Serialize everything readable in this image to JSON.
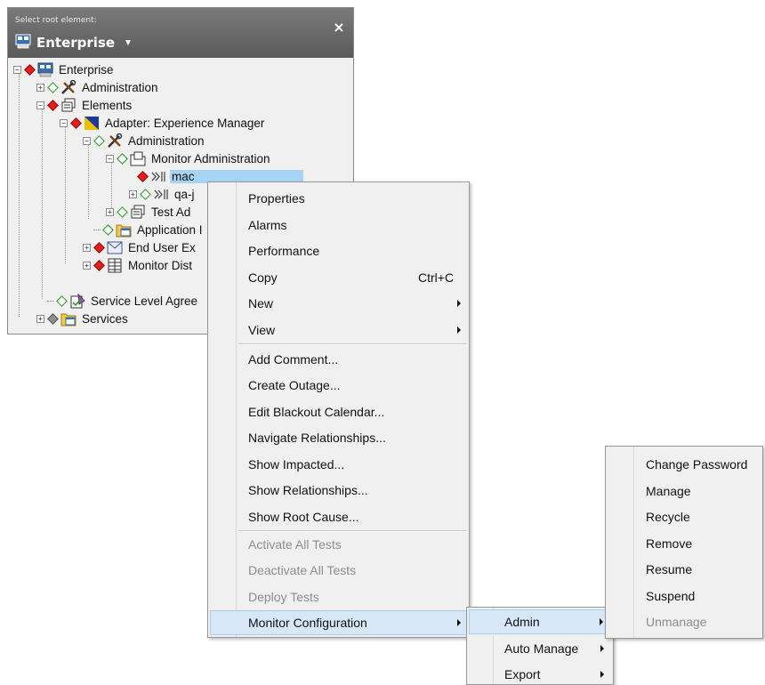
{
  "root_panel": {
    "caption": "Select root element:",
    "selected": "Enterprise",
    "close_glyph": "×"
  },
  "tree": {
    "items": [
      {
        "label": "Enterprise",
        "status": "red",
        "icon": "enterprise-icon",
        "expander": "minus"
      },
      {
        "label": "Administration",
        "status": "green",
        "icon": "tools-icon",
        "expander": "plus"
      },
      {
        "label": "Elements",
        "status": "red",
        "icon": "elements-icon",
        "expander": "minus"
      },
      {
        "label": "Adapter: Experience Manager",
        "status": "red",
        "icon": "adapter-icon",
        "expander": "minus"
      },
      {
        "label": "Administration",
        "status": "green",
        "icon": "tools-icon",
        "expander": "minus"
      },
      {
        "label": "Monitor Administration",
        "status": "green",
        "icon": "folder-icon",
        "expander": "minus"
      },
      {
        "label": "mac",
        "status": "red",
        "icon": "monitor-icon",
        "expander": "none",
        "selected": true
      },
      {
        "label": "qa-j",
        "status": "green",
        "icon": "monitor-icon",
        "expander": "plus"
      },
      {
        "label": "Test Ad",
        "status": "green",
        "icon": "elements-icon",
        "expander": "plus"
      },
      {
        "label": "Application I",
        "status": "green",
        "icon": "calendar-folder-icon",
        "expander": "none"
      },
      {
        "label": "End User Ex",
        "status": "red",
        "icon": "envelope-icon",
        "expander": "plus"
      },
      {
        "label": "Monitor Dist",
        "status": "red",
        "icon": "grid-icon",
        "expander": "plus"
      },
      {
        "label": "Service Level Agree",
        "status": "green",
        "icon": "sla-icon",
        "expander": "none"
      },
      {
        "label": "Services",
        "status": "gray",
        "icon": "calendar-folder-icon",
        "expander": "plus"
      }
    ]
  },
  "context_menu": {
    "items": [
      {
        "label": "Properties"
      },
      {
        "label": "Alarms"
      },
      {
        "label": "Performance"
      },
      {
        "label": "Copy",
        "shortcut": "Ctrl+C"
      },
      {
        "label": "New",
        "submenu": true
      },
      {
        "label": "View",
        "submenu": true
      },
      {
        "label": "Add Comment..."
      },
      {
        "label": "Create Outage..."
      },
      {
        "label": "Edit Blackout Calendar..."
      },
      {
        "label": "Navigate Relationships..."
      },
      {
        "label": "Show Impacted..."
      },
      {
        "label": "Show Relationships..."
      },
      {
        "label": "Show Root Cause..."
      },
      {
        "label": "Activate All Tests",
        "disabled": true
      },
      {
        "label": "Deactivate All Tests",
        "disabled": true
      },
      {
        "label": "Deploy Tests",
        "disabled": true
      },
      {
        "label": "Monitor Configuration",
        "submenu": true,
        "highlighted": true
      }
    ]
  },
  "monitor_config_menu": {
    "items": [
      {
        "label": "Admin",
        "submenu": true,
        "highlighted": true
      },
      {
        "label": "Auto Manage",
        "submenu": true
      },
      {
        "label": "Export",
        "submenu": true
      }
    ]
  },
  "admin_menu": {
    "items": [
      {
        "label": "Change Password"
      },
      {
        "label": "Manage"
      },
      {
        "label": "Recycle"
      },
      {
        "label": "Remove"
      },
      {
        "label": "Resume"
      },
      {
        "label": "Suspend"
      },
      {
        "label": "Unmanage",
        "disabled": true
      }
    ]
  },
  "colors": {
    "header_bg": "#6a6a6a",
    "selection": "#a6d4f2",
    "menu_bg": "#f0f0f0",
    "menu_highlight": "#d6e8f8",
    "status_red": "#e02020",
    "status_green": "#20a020"
  }
}
